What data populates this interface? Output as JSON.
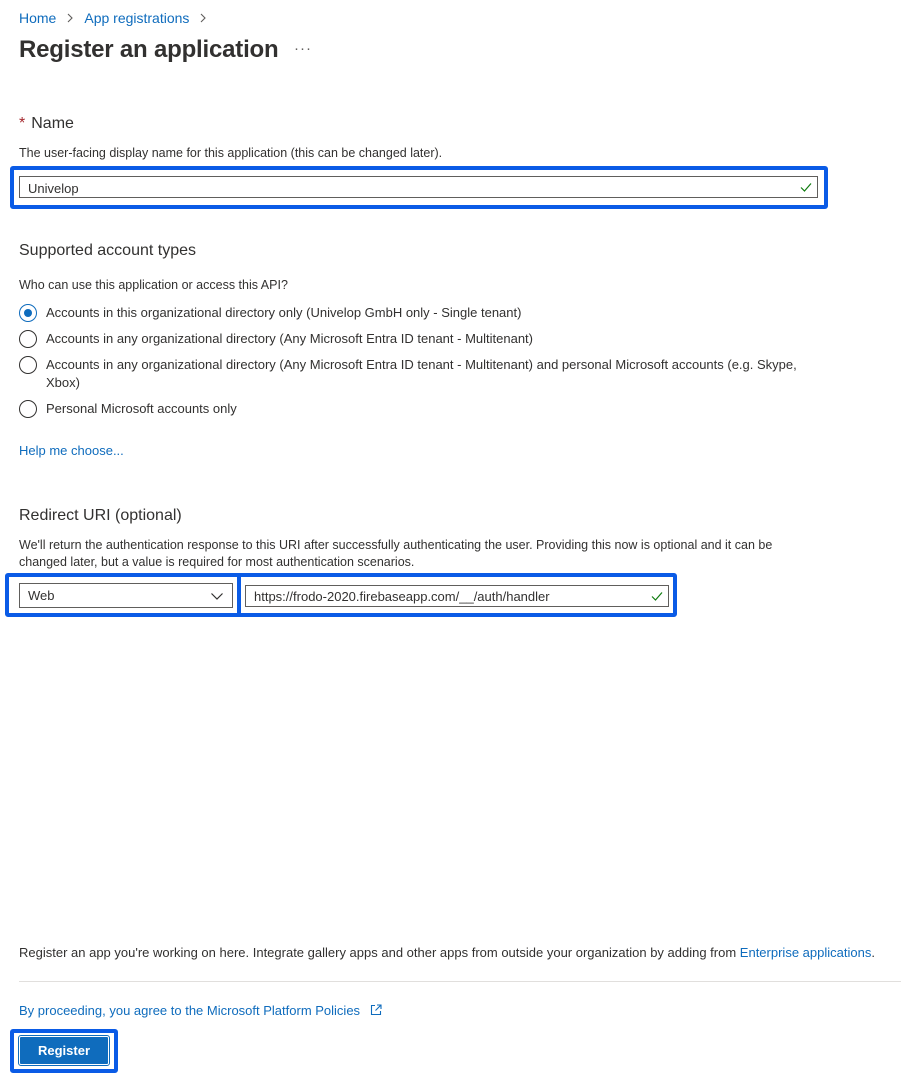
{
  "breadcrumb": {
    "home": "Home",
    "app_registrations": "App registrations"
  },
  "page": {
    "title": "Register an application",
    "more": "···"
  },
  "name_section": {
    "required_mark": "*",
    "title": "Name",
    "description": "The user-facing display name for this application (this can be changed later).",
    "value": "Univelop"
  },
  "account_types": {
    "title": "Supported account types",
    "question": "Who can use this application or access this API?",
    "options": [
      {
        "label": "Accounts in this organizational directory only (Univelop GmbH only - Single tenant)",
        "selected": true
      },
      {
        "label": "Accounts in any organizational directory (Any Microsoft Entra ID tenant - Multitenant)",
        "selected": false
      },
      {
        "label": "Accounts in any organizational directory (Any Microsoft Entra ID tenant - Multitenant) and personal Microsoft accounts (e.g. Skype, Xbox)",
        "selected": false
      },
      {
        "label": "Personal Microsoft accounts only",
        "selected": false
      }
    ],
    "help_link": "Help me choose..."
  },
  "redirect": {
    "title": "Redirect URI (optional)",
    "description": "We'll return the authentication response to this URI after successfully authenticating the user. Providing this now is optional and it can be changed later, but a value is required for most authentication scenarios.",
    "platform": "Web",
    "uri": "https://frodo-2020.firebaseapp.com/__/auth/handler"
  },
  "footer": {
    "info_text": "Register an app you're working on here. Integrate gallery apps and other apps from outside your organization by adding from ",
    "enterprise_link": "Enterprise applications",
    "info_end": ".",
    "policy_link": "By proceeding, you agree to the Microsoft Platform Policies",
    "register_label": "Register"
  },
  "colors": {
    "accent": "#0f6cbd",
    "highlight": "#0a5be6",
    "required": "#a4262c",
    "success": "#107c10"
  },
  "icons": [
    "chevron-right-icon",
    "checkmark-icon",
    "chevron-down-icon",
    "external-link-icon"
  ]
}
